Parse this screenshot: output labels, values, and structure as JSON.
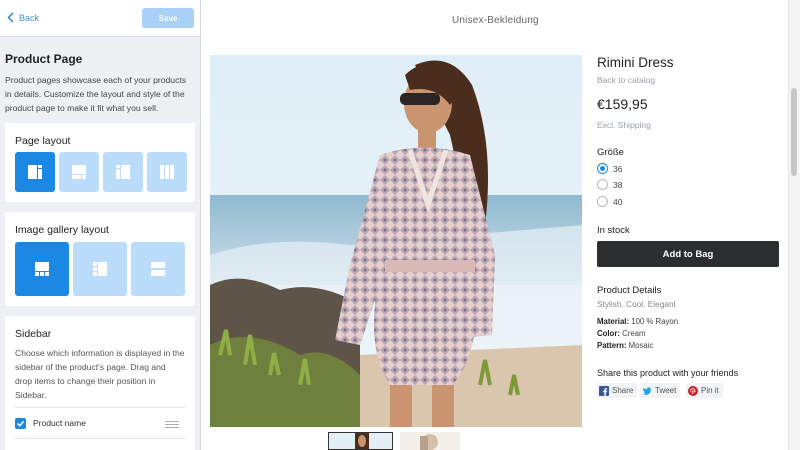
{
  "editor": {
    "back_label": "Back",
    "save_label": "Save",
    "section_title": "Product Page",
    "section_desc": "Product pages showcase each of your products in details. Customize the layout and style of the product page to make it fit what you sell.",
    "page_layout_title": "Page layout",
    "page_layout_selected": 0,
    "gallery_layout_title": "Image gallery layout",
    "gallery_layout_selected": 0,
    "sidebar_title": "Sidebar",
    "sidebar_desc": "Choose which information is displayed in the sidebar of the product's page. Drag and drop items to change their position in Sidebar.",
    "sidebar_items": [
      {
        "label": "Product name",
        "checked": true
      }
    ]
  },
  "store": {
    "title": "Unisex-Bekleidung",
    "product": {
      "name": "Rimini Dress",
      "back_link": "Back to catalog",
      "price": "€159,95",
      "shipping": "Excl. Shipping",
      "size_label": "Größe",
      "sizes": [
        "36",
        "38",
        "40"
      ],
      "selected_size": "36",
      "stock": "In stock",
      "add_to_bag": "Add to Bag",
      "details_heading": "Product Details",
      "details_sub": "Stylish. Cool. Elegant",
      "specs": [
        {
          "key": "Material:",
          "value": "100 % Rayon"
        },
        {
          "key": "Color:",
          "value": "Cream"
        },
        {
          "key": "Pattern:",
          "value": "Mosaic"
        }
      ],
      "share_heading": "Share this product with your friends",
      "share_buttons": [
        {
          "label": "Share",
          "icon": "facebook-icon"
        },
        {
          "label": "Tweet",
          "icon": "twitter-icon"
        },
        {
          "label": "Pin it",
          "icon": "pinterest-icon"
        }
      ]
    }
  },
  "colors": {
    "accent": "#1b88e3",
    "accent_light": "#bcdcfb",
    "button_dark": "#2b2d2f",
    "panel_bg": "#eef0f3"
  }
}
